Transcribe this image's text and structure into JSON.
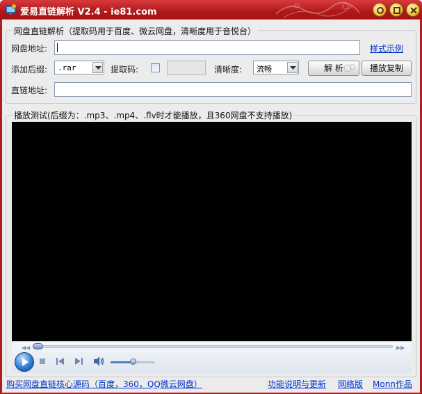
{
  "window": {
    "title": "爱易直链解析 V2.4 - ie81.com"
  },
  "title_buttons": {
    "help": "help",
    "minimize": "minimize",
    "close": "close"
  },
  "netdisk_group": {
    "caption": "网盘直链解析（提取码用于百度、微云网盘，清晰度用于音悦台）",
    "url_label": "网盘地址:",
    "url_value": "",
    "style_example_link": "样式示例",
    "suffix_label": "添加后缀:",
    "suffix_value": ".rar",
    "extract_code_label": "提取码:",
    "extract_code_value": "",
    "clarity_label": "清晰度:",
    "clarity_value": "流畅",
    "parse_button": "解 析",
    "copy_play_button": "播放复制",
    "direct_link_label": "直链地址:",
    "direct_link_value": ""
  },
  "player_group": {
    "caption": "播放测试(后缀为：.mp3、.mp4、.flv时才能播放，且360网盘不支持播放)",
    "seek_fraction": 0,
    "volume_fraction": 0.5
  },
  "footer": {
    "buy_source_link": "购买网盘直链核心源码（百度，360，QQ微云网盘）",
    "function_notes_link": "功能说明与更新",
    "network_version_link": "网络版",
    "author_link": "Monn作品"
  },
  "colors": {
    "title_bar": "#b31c1c",
    "link": "#0033cc",
    "background": "#ececec",
    "video": "#000000"
  },
  "icons": {
    "app": "app-icon",
    "help": "help-icon",
    "minimize": "minimize-icon",
    "close": "close-icon",
    "play": "play-icon",
    "stop": "stop-icon",
    "previous": "previous-icon",
    "next": "next-icon",
    "volume": "volume-icon"
  }
}
